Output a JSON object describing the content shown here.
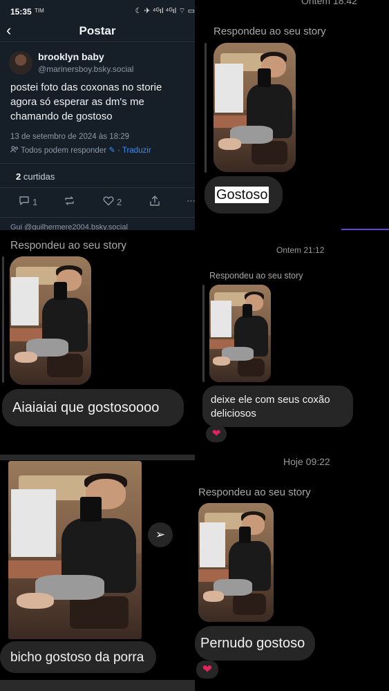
{
  "bsky": {
    "statusbar": {
      "time": "15:35",
      "indicators": "TIM",
      "right_icons": "☾ ✈ ⁴ᴳıl ⁴ᴳıl ⌔ ▭"
    },
    "nav": {
      "back": "‹",
      "title": "Postar"
    },
    "post": {
      "author_name": "brooklyn baby",
      "author_handle": "@marinersboy.bsky.social",
      "text_lines": [
        "postei foto das coxonas no storie",
        "agora só esperar as dm's me",
        "chamando de gostoso"
      ],
      "date": "13 de setembro de 2024 às 18:29",
      "reply_setting": "Todos podem responder",
      "translate": "Traduzir",
      "likes_count": "2",
      "likes_label": "curtidas",
      "reply_count": "1",
      "like_count": "2",
      "next_reply_preview": "Gui @guilhermere2004.bsky.social"
    }
  },
  "chat1": {
    "timestamp": "Ontem 18:42",
    "reply_label": "Respondeu ao seu story",
    "message": "Gostoso"
  },
  "chat2": {
    "reply_label": "Respondeu ao seu story",
    "message": "Aiaiaiai que gostosoooo"
  },
  "chat3": {
    "timestamp": "Ontem 21:12",
    "reply_label": "Respondeu ao seu story",
    "message_lines": [
      "deixe ele com seus coxão",
      "deliciosos"
    ],
    "reaction": "❤"
  },
  "chat4": {
    "message": "bicho gostoso da porra",
    "send_icon": "➢"
  },
  "chat5": {
    "timestamp": "Hoje 09:22",
    "reply_label": "Respondeu ao seu story",
    "message": "Pernudo gostoso",
    "reaction": "❤"
  },
  "colors": {
    "bsky_bg": "#161e27",
    "bubble": "#262626",
    "link": "#3b8ef0",
    "accent": "#6a3fd0",
    "heart": "#e0245e"
  }
}
